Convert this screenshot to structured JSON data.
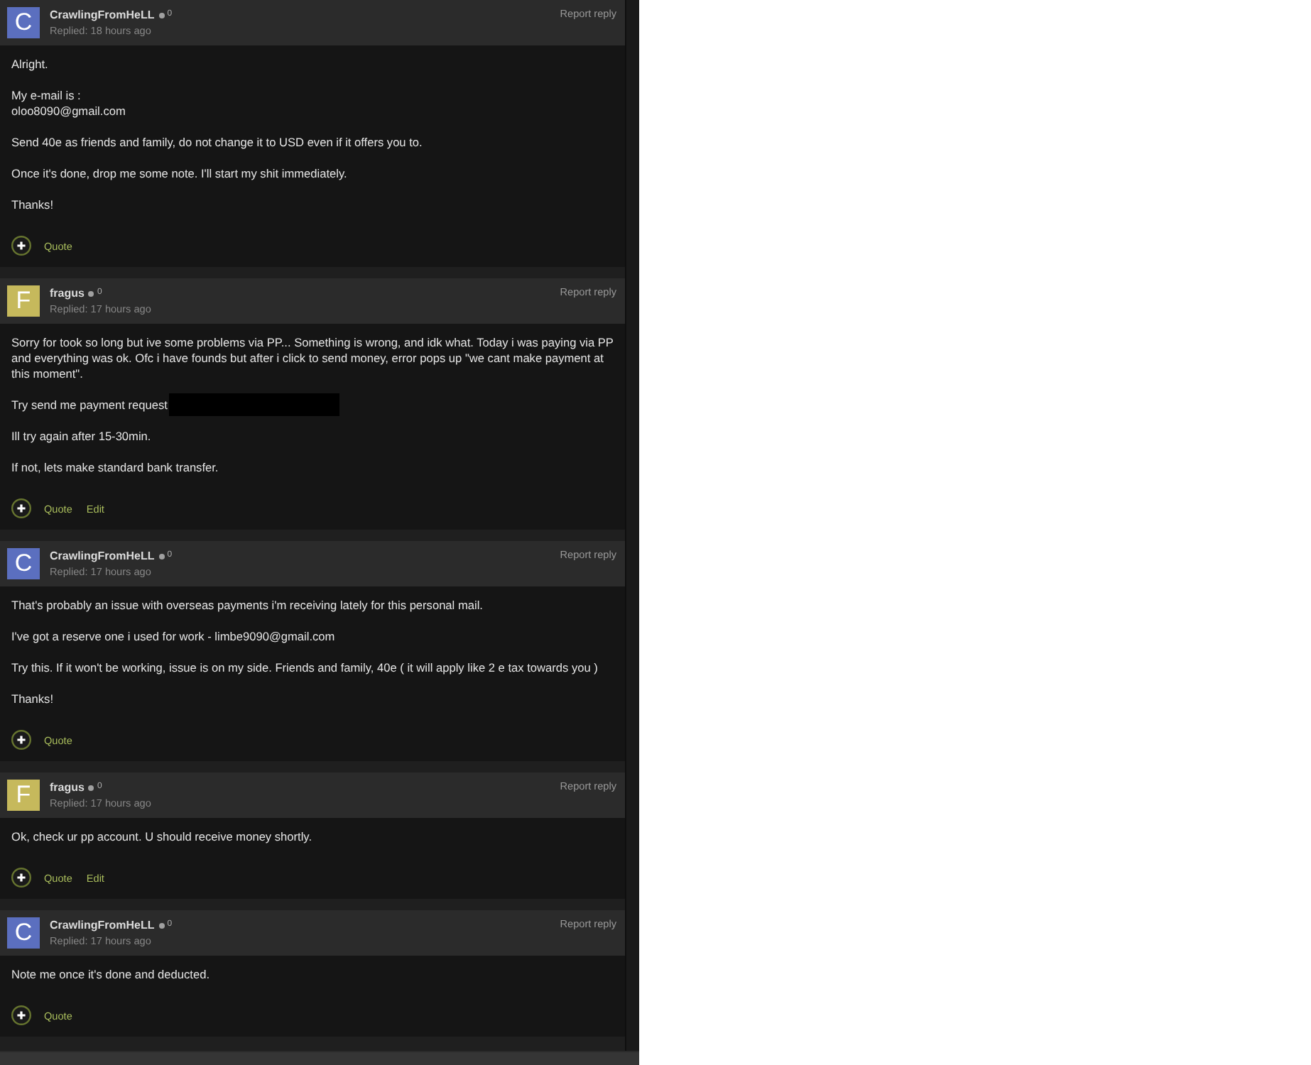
{
  "posts": [
    {
      "author": "CrawlingFromHeLL",
      "avatar": {
        "letter": "C",
        "color": "#5b6fbf"
      },
      "reputation": "0",
      "replied": "Replied: 18 hours ago",
      "report": "Report reply",
      "body": [
        {
          "text": "Alright.",
          "redacted": false
        },
        {
          "text": "My e-mail is :\noloo8090@gmail.com",
          "redacted": false
        },
        {
          "text": "Send 40e as friends and family, do not change it to USD even if it offers you to.",
          "redacted": false
        },
        {
          "text": "Once it's done, drop me some note. I'll start my shit immediately.",
          "redacted": false
        },
        {
          "text": "Thanks!",
          "redacted": false
        }
      ],
      "actions": [
        "Quote"
      ]
    },
    {
      "author": "fragus",
      "avatar": {
        "letter": "F",
        "color": "#c6b95c"
      },
      "reputation": "0",
      "replied": "Replied: 17 hours ago",
      "report": "Report reply",
      "body": [
        {
          "text": "Sorry for took so long but ive some problems via PP... Something is wrong, and idk what. Today i was paying via PP and everything was ok. Ofc i have founds but after i click to send money, error pops up \"we cant make payment at this moment\".",
          "redacted": false
        },
        {
          "text": "Try send me payment request",
          "redacted": true
        },
        {
          "text": "Ill try again after 15-30min.",
          "redacted": false
        },
        {
          "text": "If not, lets make standard bank transfer.",
          "redacted": false
        }
      ],
      "actions": [
        "Quote",
        "Edit"
      ]
    },
    {
      "author": "CrawlingFromHeLL",
      "avatar": {
        "letter": "C",
        "color": "#5b6fbf"
      },
      "reputation": "0",
      "replied": "Replied: 17 hours ago",
      "report": "Report reply",
      "body": [
        {
          "text": "That's probably an issue with overseas payments i'm receiving lately for this personal mail.",
          "redacted": false
        },
        {
          "text": "I've got a reserve one i used for work - limbe9090@gmail.com",
          "redacted": false
        },
        {
          "text": "Try this. If it won't be working, issue is on my side. Friends and family, 40e ( it will apply like 2 e tax towards you )",
          "redacted": false
        },
        {
          "text": "Thanks!",
          "redacted": false
        }
      ],
      "actions": [
        "Quote"
      ]
    },
    {
      "author": "fragus",
      "avatar": {
        "letter": "F",
        "color": "#c6b95c"
      },
      "reputation": "0",
      "replied": "Replied: 17 hours ago",
      "report": "Report reply",
      "body": [
        {
          "text": "Ok, check ur pp account. U should receive money shortly.",
          "redacted": false
        }
      ],
      "actions": [
        "Quote",
        "Edit"
      ]
    },
    {
      "author": "CrawlingFromHeLL",
      "avatar": {
        "letter": "C",
        "color": "#5b6fbf"
      },
      "reputation": "0",
      "replied": "Replied: 17 hours ago",
      "report": "Report reply",
      "body": [
        {
          "text": "Note me once it's done and deducted.",
          "redacted": false
        }
      ],
      "actions": [
        "Quote"
      ]
    }
  ]
}
